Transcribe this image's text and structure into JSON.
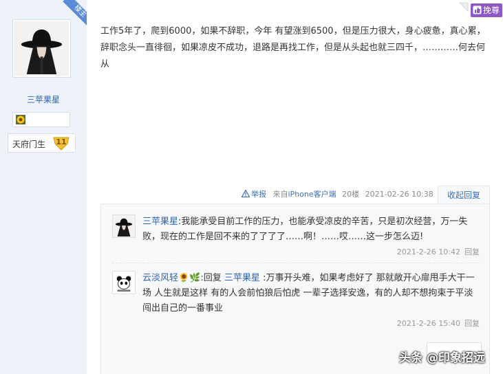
{
  "sidebar": {
    "owner_badge": "楼主",
    "username": "三苹果星",
    "level_name": "天府门生",
    "level_number": "11"
  },
  "header": {
    "save_label": "挽尊"
  },
  "post": {
    "content": "工作5年了，爬到6000，如果不辞职，今年 有望涨到6500，但是压力很大，身心疲惫，真心累，辞职念头一直徘徊，如果凉皮不成功，退路是再找工作，但是从头起也就三四千，…………何去何从",
    "report_label": "举报",
    "client_prefix": "来自",
    "client_name": "iPhone客户端",
    "floor": "20楼",
    "time": "2021-02-26 10:38",
    "collapse_label": "收起回复"
  },
  "replies": [
    {
      "author": "三苹果星",
      "separator": ":",
      "text": "我能承受目前工作的压力，也能承受凉皮的辛苦，只是初次经营，万一失败，现在的工作是回不来的了了了了……啊！……哎……这一步怎么迈!",
      "time": "2021-2-26 10:42",
      "reply_label": "回复"
    },
    {
      "author": "云淡风轻",
      "author_emoji": "🌻🌿",
      "reply_word": ":回复",
      "target": "三苹果星",
      "separator": ":",
      "text": "万事开头难，如果考虑好了 那就敞开心扉甩手大干一场 人生就是这样 有的人会前怕狼后怕虎 一辈子选择安逸，有的人却不想拘束于平淡 闯出自己的一番事业",
      "time": "2021-2-26 15:40",
      "reply_label": "回复"
    }
  ],
  "watermark": "头条 @印象招远",
  "colors": {
    "accent_link": "#2d64b3",
    "save_button": "#8e56c7",
    "owner_ribbon": "#5b8ad8",
    "sidebar_bg": "#eef3fa"
  }
}
